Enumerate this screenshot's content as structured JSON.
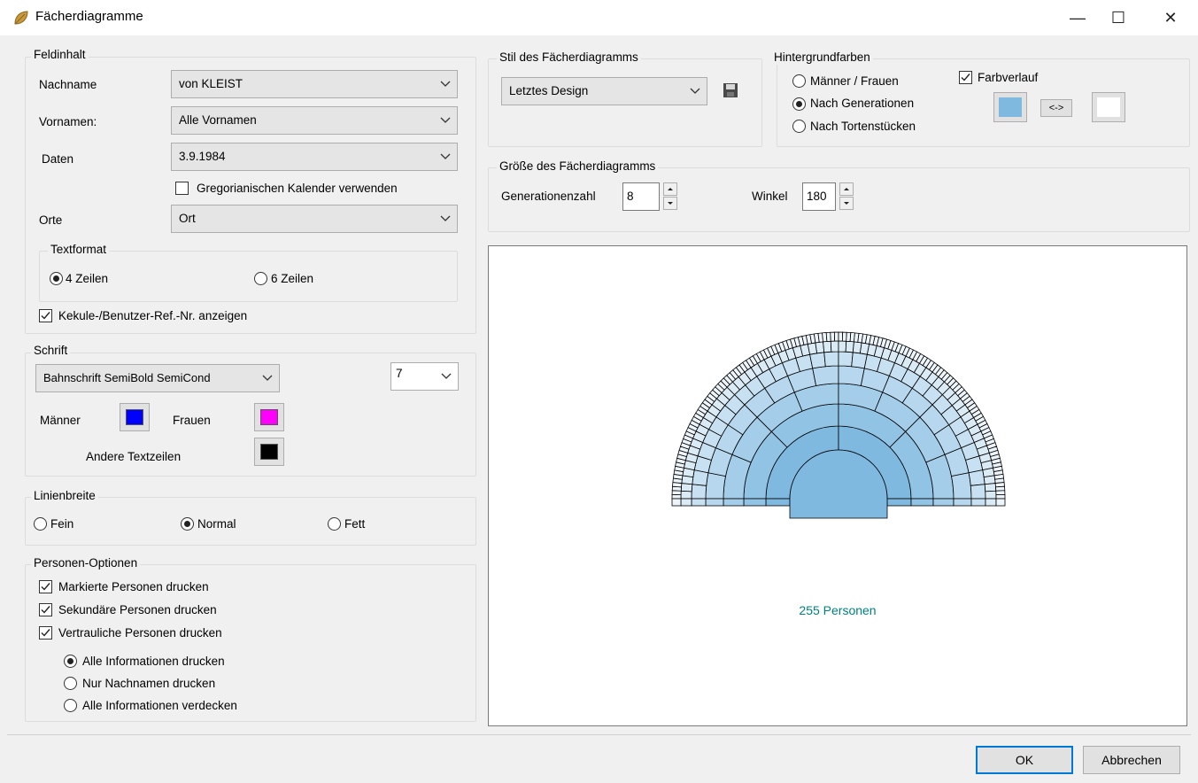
{
  "window": {
    "title": "Fächerdiagramme",
    "controls": {
      "minimize": "—",
      "maximize": "☐",
      "close": "✕"
    }
  },
  "feldinhalt": {
    "group_label": "Feldinhalt",
    "nachname_label": "Nachname",
    "nachname_value": "von KLEIST",
    "vornamen_label": "Vornamen:",
    "vornamen_value": "Alle Vornamen",
    "daten_label": "Daten",
    "daten_value": "3.9.1984",
    "gregorian_label": "Gregorianischen Kalender verwenden",
    "gregorian_checked": false,
    "orte_label": "Orte",
    "orte_value": "Ort",
    "textformat_label": "Textformat",
    "zeilen4_label": "4 Zeilen",
    "zeilen6_label": "6 Zeilen",
    "textformat_selected": "4 Zeilen",
    "kekule_label": "Kekule-/Benutzer-Ref.-Nr. anzeigen",
    "kekule_checked": true
  },
  "schrift": {
    "group_label": "Schrift",
    "font_value": "Bahnschrift SemiBold SemiCond",
    "size_value": "7",
    "maenner_label": "Männer",
    "maenner_color": "#0000ff",
    "frauen_label": "Frauen",
    "frauen_color": "#ff00ff",
    "andere_label": "Andere Textzeilen",
    "andere_color": "#000000"
  },
  "linienbreite": {
    "group_label": "Linienbreite",
    "fein_label": "Fein",
    "normal_label": "Normal",
    "fett_label": "Fett",
    "selected": "Normal"
  },
  "personen": {
    "group_label": "Personen-Optionen",
    "markierte_label": "Markierte Personen drucken",
    "sekundaere_label": "Sekundäre Personen drucken",
    "vertrauliche_label": "Vertrauliche Personen drucken",
    "alle_info_label": "Alle Informationen drucken",
    "nur_nachnamen_label": "Nur Nachnamen drucken",
    "verdecken_label": "Alle Informationen verdecken",
    "selected": "Alle Informationen drucken"
  },
  "stil": {
    "group_label": "Stil des Fächerdiagramms",
    "design_value": "Letztes Design"
  },
  "hintergrund": {
    "group_label": "Hintergrundfarben",
    "maenner_frauen_label": "Männer / Frauen",
    "generationen_label": "Nach Generationen",
    "tortenstuecke_label": "Nach Tortenstücken",
    "selected": "Nach Generationen",
    "farbverlauf_label": "Farbverlauf",
    "farbverlauf_checked": true,
    "color_start": "#7fb9e0",
    "color_end": "#ffffff",
    "swap_label": "<->"
  },
  "groesse": {
    "group_label": "Größe des Fächerdiagramms",
    "generationen_label": "Generationenzahl",
    "generationen_value": "8",
    "winkel_label": "Winkel",
    "winkel_value": "180"
  },
  "preview": {
    "count_text": "255  Personen",
    "count_color": "#008080",
    "fill_inner": "#7fb9e0",
    "fill_outer": "#ffffff"
  },
  "buttons": {
    "ok_label": "OK",
    "cancel_label": "Abbrechen"
  }
}
